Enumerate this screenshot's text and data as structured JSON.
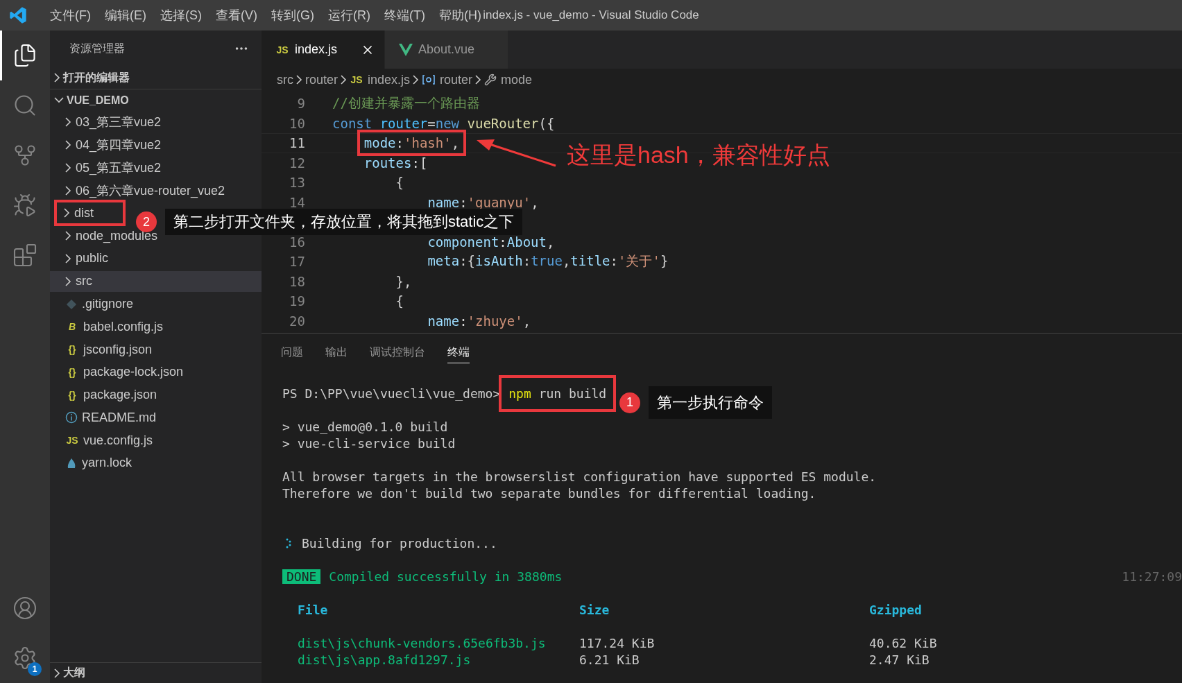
{
  "window": {
    "title": "index.js - vue_demo - Visual Studio Code"
  },
  "menu": [
    "文件(F)",
    "编辑(E)",
    "选择(S)",
    "查看(V)",
    "转到(G)",
    "运行(R)",
    "终端(T)",
    "帮助(H)"
  ],
  "activity_bar": {
    "items": [
      {
        "kind": "explorer",
        "selected": true
      },
      {
        "kind": "search",
        "selected": false
      },
      {
        "kind": "source_control",
        "selected": false
      },
      {
        "kind": "run",
        "selected": false
      },
      {
        "kind": "extensions",
        "selected": false
      }
    ],
    "bottom": [
      {
        "kind": "account"
      },
      {
        "kind": "settings",
        "badge": "1"
      }
    ]
  },
  "explorer": {
    "title": "资源管理器",
    "sections": [
      {
        "label": "打开的编辑器",
        "expanded": false
      },
      {
        "label": "VUE_DEMO",
        "expanded": true,
        "children": [
          {
            "name": "03_第三章vue2",
            "kind": "folder",
            "expanded": false,
            "selected": false
          },
          {
            "name": "04_第四章vue2",
            "kind": "folder",
            "expanded": false,
            "selected": false
          },
          {
            "name": "05_第五章vue2",
            "kind": "folder",
            "expanded": false,
            "selected": false
          },
          {
            "name": "06_第六章vue-router_vue2",
            "kind": "folder",
            "expanded": false,
            "selected": false
          },
          {
            "name": "dist",
            "kind": "folder",
            "expanded": false,
            "selected": false,
            "boxed": true,
            "callout": {
              "badge": "2",
              "text": "第二步打开文件夹，存放位置，将其拖到static之下"
            }
          },
          {
            "name": "node_modules",
            "kind": "folder",
            "expanded": false,
            "selected": false
          },
          {
            "name": "public",
            "kind": "folder",
            "expanded": false,
            "selected": false
          },
          {
            "name": "src",
            "kind": "folder",
            "expanded": false,
            "selected": true
          },
          {
            "name": ".gitignore",
            "kind": "git",
            "selected": false
          },
          {
            "name": "babel.config.js",
            "kind": "babel",
            "icon_label": "B",
            "selected": false
          },
          {
            "name": "jsconfig.json",
            "kind": "json",
            "icon_label": "{}",
            "selected": false
          },
          {
            "name": "package-lock.json",
            "kind": "json",
            "icon_label": "{}",
            "selected": false
          },
          {
            "name": "package.json",
            "kind": "json",
            "icon_label": "{}",
            "selected": false
          },
          {
            "name": "README.md",
            "kind": "info",
            "selected": false
          },
          {
            "name": "vue.config.js",
            "kind": "js",
            "icon_label": "JS",
            "selected": false
          },
          {
            "name": "yarn.lock",
            "kind": "yarn",
            "selected": false
          }
        ]
      }
    ],
    "outline": {
      "label": "大纲",
      "expanded": false
    }
  },
  "tabs": [
    {
      "label": "index.js",
      "kind": "js",
      "icon_label": "JS",
      "selected": true
    },
    {
      "label": "About.vue",
      "kind": "vue",
      "selected": false
    }
  ],
  "breadcrumb": [
    {
      "kind": "folder",
      "text": "src"
    },
    {
      "kind": "folder",
      "text": "router"
    },
    {
      "kind": "js",
      "icon_label": "JS",
      "text": "index.js"
    },
    {
      "kind": "object",
      "text": "router"
    },
    {
      "kind": "property",
      "text": "mode"
    }
  ],
  "code": [
    {
      "number": "9",
      "tokens": [
        {
          "kind": "comment",
          "text": "//创建并暴露一个路由器"
        }
      ]
    },
    {
      "number": "10",
      "tokens": [
        {
          "kind": "keyword",
          "text": "const "
        },
        {
          "kind": "variable",
          "text": "router"
        },
        {
          "kind": "punct",
          "text": "="
        },
        {
          "kind": "keyword",
          "text": "new "
        },
        {
          "kind": "function",
          "text": "vueRouter"
        },
        {
          "kind": "punct",
          "text": "({"
        }
      ]
    },
    {
      "number": "11",
      "current": true,
      "boxed": true,
      "note": "这里是hash，兼容性好点",
      "tokens": [
        {
          "kind": "property",
          "text": "    mode"
        },
        {
          "kind": "punct",
          "text": ":"
        },
        {
          "kind": "string",
          "text": "'hash'"
        },
        {
          "kind": "punct",
          "text": ","
        }
      ]
    },
    {
      "number": "12",
      "tokens": [
        {
          "kind": "property",
          "text": "    routes"
        },
        {
          "kind": "punct",
          "text": ":["
        }
      ]
    },
    {
      "number": "13",
      "tokens": [
        {
          "kind": "punct",
          "text": "        {"
        }
      ]
    },
    {
      "number": "14",
      "tokens": [
        {
          "kind": "property",
          "text": "            name"
        },
        {
          "kind": "punct",
          "text": ":"
        },
        {
          "kind": "string",
          "text": "'guanyu'"
        },
        {
          "kind": "punct",
          "text": ","
        }
      ]
    },
    {
      "number": "16",
      "tokens": [
        {
          "kind": "property",
          "text": "            component"
        },
        {
          "kind": "punct",
          "text": ":"
        },
        {
          "kind": "property",
          "text": "About"
        },
        {
          "kind": "punct",
          "text": ","
        }
      ]
    },
    {
      "number": "17",
      "tokens": [
        {
          "kind": "property",
          "text": "            meta"
        },
        {
          "kind": "punct",
          "text": ":{"
        },
        {
          "kind": "property",
          "text": "isAuth"
        },
        {
          "kind": "punct",
          "text": ":"
        },
        {
          "kind": "keyword",
          "text": "true"
        },
        {
          "kind": "punct",
          "text": ","
        },
        {
          "kind": "property",
          "text": "title"
        },
        {
          "kind": "punct",
          "text": ":"
        },
        {
          "kind": "string",
          "text": "'关于'"
        },
        {
          "kind": "punct",
          "text": "}"
        }
      ]
    },
    {
      "number": "18",
      "tokens": [
        {
          "kind": "punct",
          "text": "        },"
        }
      ]
    },
    {
      "number": "19",
      "tokens": [
        {
          "kind": "punct",
          "text": "        {"
        }
      ]
    },
    {
      "number": "20",
      "tokens": [
        {
          "kind": "property",
          "text": "            name"
        },
        {
          "kind": "punct",
          "text": ":"
        },
        {
          "kind": "string",
          "text": "'zhuye'"
        },
        {
          "kind": "punct",
          "text": ","
        }
      ]
    }
  ],
  "panel_tabs": [
    {
      "label": "问题",
      "selected": false
    },
    {
      "label": "输出",
      "selected": false
    },
    {
      "label": "调试控制台",
      "selected": false
    },
    {
      "label": "终端",
      "selected": true
    }
  ],
  "terminal": [
    {
      "kind": "prompt",
      "prompt": "PS D:\\PP\\vue\\vuecli\\vue_demo>",
      "command": "npm",
      "args": "run build",
      "boxed": true,
      "callout": {
        "badge": "1",
        "text": "第一步执行命令"
      }
    },
    {
      "kind": "blank"
    },
    {
      "kind": "text",
      "text": "> vue_demo@0.1.0 build"
    },
    {
      "kind": "text",
      "text": "> vue-cli-service build"
    },
    {
      "kind": "blank"
    },
    {
      "kind": "text",
      "text": "All browser targets in the browserslist configuration have supported ES module."
    },
    {
      "kind": "text",
      "text": "Therefore we don't build two separate bundles for differential loading."
    },
    {
      "kind": "blank"
    },
    {
      "kind": "blank"
    },
    {
      "kind": "spinner",
      "text": "Building for production..."
    },
    {
      "kind": "blank"
    },
    {
      "kind": "done",
      "tag": "DONE",
      "text": "Compiled successfully in 3880ms",
      "time": "11:27:09"
    },
    {
      "kind": "blank"
    },
    {
      "kind": "header",
      "cells": [
        "File",
        "Size",
        "Gzipped"
      ]
    },
    {
      "kind": "blank"
    },
    {
      "kind": "row",
      "cells": [
        "dist\\js\\chunk-vendors.65e6fb3b.js",
        "117.24 KiB",
        "40.62 KiB"
      ]
    },
    {
      "kind": "row",
      "cells": [
        "dist\\js\\app.8afd1297.js",
        "6.21 KiB",
        "2.47 KiB"
      ]
    }
  ]
}
